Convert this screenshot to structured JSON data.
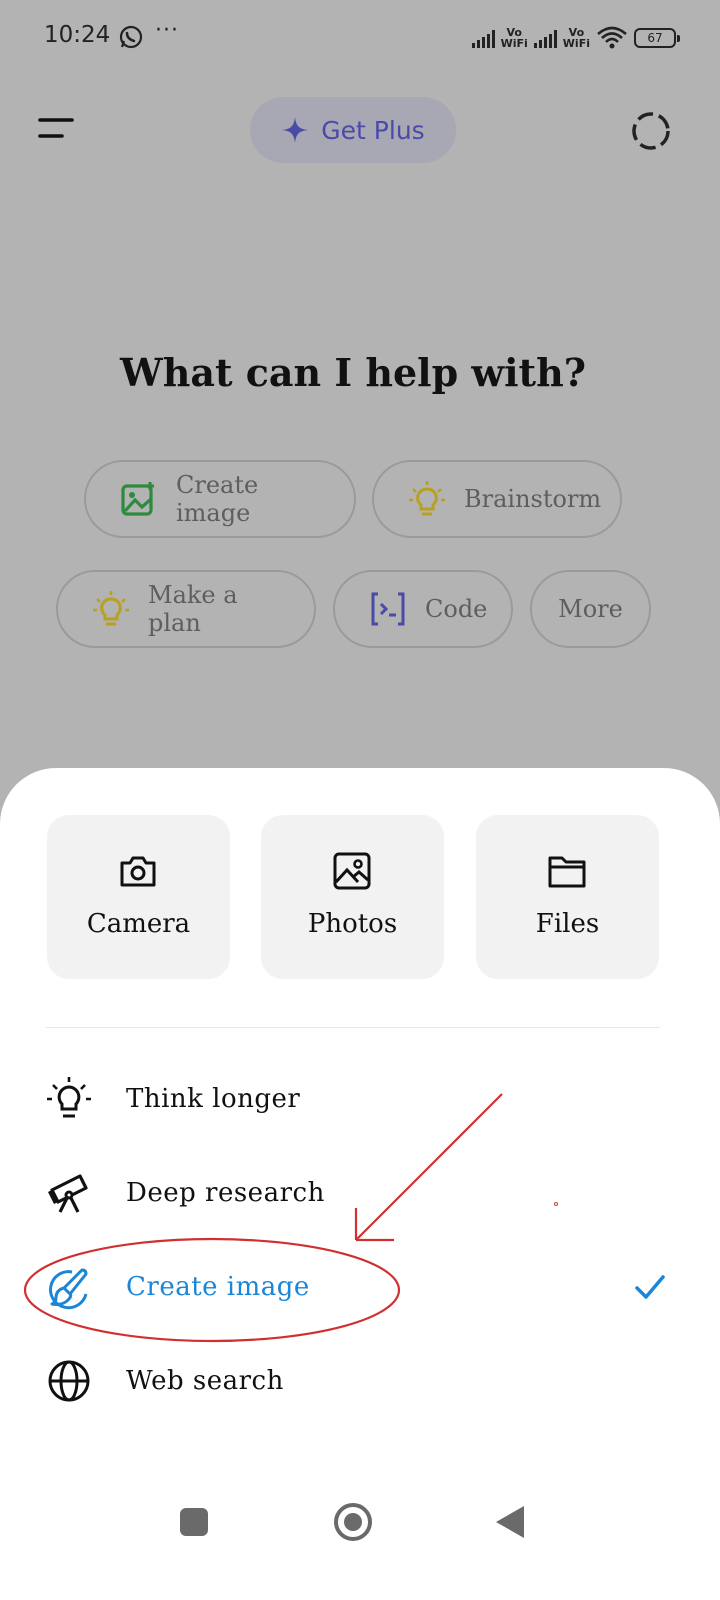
{
  "status_bar": {
    "time": "10:24",
    "more": "···",
    "network_1": "Vo\nWiFi",
    "network_2": "Vo\nWiFi",
    "battery": "67"
  },
  "header": {
    "get_plus_label": "Get Plus"
  },
  "main": {
    "headline": "What can I help with?",
    "chips": [
      {
        "label": "Create image",
        "icon": "create-image-icon"
      },
      {
        "label": "Brainstorm",
        "icon": "lightbulb-icon"
      },
      {
        "label": "Make a plan",
        "icon": "lightbulb-icon"
      },
      {
        "label": "Code",
        "icon": "code-icon"
      },
      {
        "label": "More"
      }
    ]
  },
  "sheet": {
    "tiles": [
      {
        "label": "Camera",
        "icon": "camera-icon"
      },
      {
        "label": "Photos",
        "icon": "photos-icon"
      },
      {
        "label": "Files",
        "icon": "folder-icon"
      }
    ],
    "options": [
      {
        "label": "Think longer",
        "icon": "lightbulb-icon"
      },
      {
        "label": "Deep research",
        "icon": "telescope-icon"
      },
      {
        "label": "Create image",
        "icon": "paintbrush-icon",
        "selected": true
      },
      {
        "label": "Web search",
        "icon": "globe-icon"
      }
    ]
  },
  "colors": {
    "accent_blue": "#1a86d8",
    "annotation_red": "#d03030",
    "get_plus_text": "#4a4aa8"
  }
}
